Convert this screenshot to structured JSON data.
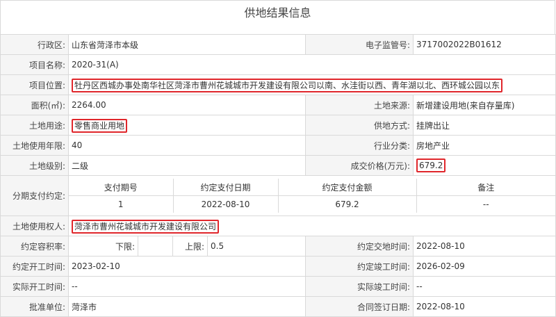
{
  "page_title": "供地结果信息",
  "highlight_color": "#e0262b",
  "fields": {
    "district_label": "行政区:",
    "district": "山东省菏泽市本级",
    "supervision_no_label": "电子监管号:",
    "supervision_no": "3717002022B01612",
    "project_name_label": "项目名称:",
    "project_name": "2020-31(A)",
    "location_label": "项目位置:",
    "location": "牡丹区西城办事处南华社区菏泽市曹州花城城市开发建设有限公司以南、水洼街以西、青年湖以北、西环城公园以东",
    "area_label": "面积(㎡):",
    "area": "2264.00",
    "land_source_label": "土地来源:",
    "land_source": "新增建设用地(来自存量库)",
    "land_use_label": "土地用途:",
    "land_use": "零售商业用地",
    "supply_method_label": "供地方式:",
    "supply_method": "挂牌出让",
    "use_years_label": "土地使用年限:",
    "use_years": "40",
    "industry_label": "行业分类:",
    "industry": "房地产业",
    "land_grade_label": "土地级别:",
    "land_grade": "二级",
    "price_label": "成交价格(万元):",
    "price": "679.2",
    "installment_label": "分期支付约定:",
    "owner_label": "土地使用权人:",
    "owner": "菏泽市曹州花城城市开发建设有限公司",
    "far_label": "约定容积率:",
    "far_lower_label": "下限:",
    "far_lower": "",
    "far_upper_label": "上限:",
    "far_upper": "0.5",
    "delivery_date_label": "约定交地时间:",
    "delivery_date": "2022-08-10",
    "start_date_label": "约定开工时间:",
    "start_date": "2023-02-10",
    "complete_date_label": "约定竣工时间:",
    "complete_date": "2026-02-09",
    "actual_start_label": "实际开工时间:",
    "actual_start": "--",
    "actual_complete_label": "实际竣工时间:",
    "actual_complete": "--",
    "approver_label": "批准单位:",
    "approver": "菏泽市",
    "contract_date_label": "合同签订日期:",
    "contract_date": "2022-08-10"
  },
  "payments": {
    "headers": [
      "支付期号",
      "约定支付日期",
      "约定支付金额",
      "备注"
    ],
    "rows": [
      [
        "1",
        "2022-08-10",
        "679.2",
        "--"
      ]
    ]
  }
}
